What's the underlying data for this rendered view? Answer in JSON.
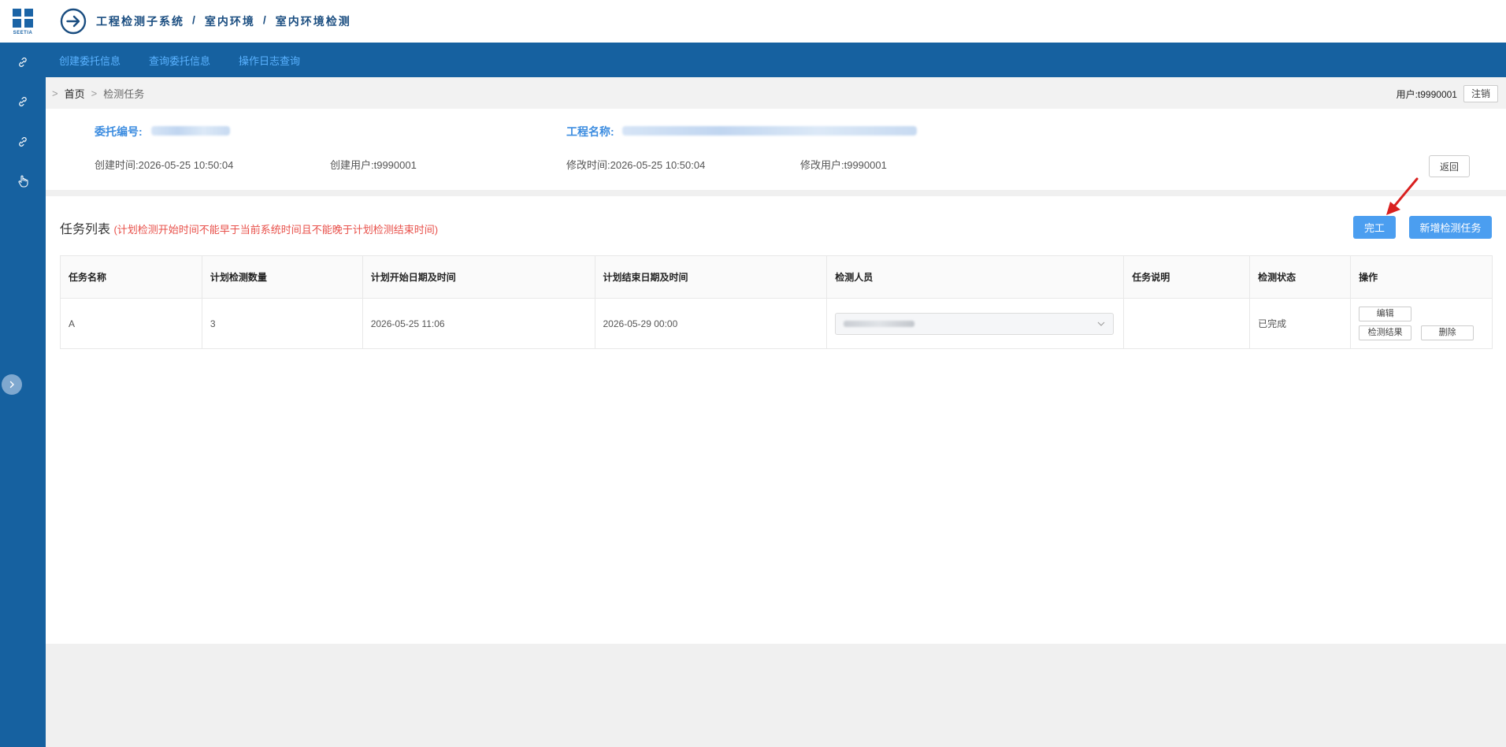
{
  "logo": {
    "text": "SEETIA"
  },
  "header": {
    "crumbs": [
      "工程检测子系统",
      "室内环境",
      "室内环境检测"
    ],
    "separator": "/"
  },
  "nav": {
    "items": [
      {
        "label": "创建委托信息"
      },
      {
        "label": "查询委托信息"
      },
      {
        "label": "操作日志查询"
      }
    ]
  },
  "rail": {
    "icons": [
      "link-icon",
      "link-icon",
      "link-icon",
      "pointer-hand-icon"
    ],
    "toggle_icon": "chevron-right-icon"
  },
  "subbar": {
    "sep": ">",
    "home": "首页",
    "current": "检测任务",
    "user_label": "用户:t9990001",
    "logout_label": "注销"
  },
  "info": {
    "entrust_no_label": "委托编号:",
    "project_name_label": "工程名称:",
    "created_time": "创建时间:2026-05-25 10:50:04",
    "created_user": "创建用户:t9990001",
    "modified_time": "修改时间:2026-05-25 10:50:04",
    "modified_user": "修改用户:t9990001",
    "back_label": "返回"
  },
  "tasks": {
    "title": "任务列表",
    "note": "(计划检测开始时间不能早于当前系统时间且不能晚于计划检测结束时间)",
    "finish_label": "完工",
    "add_label": "新增检测任务",
    "columns": [
      "任务名称",
      "计划检测数量",
      "计划开始日期及时间",
      "计划结束日期及时间",
      "检测人员",
      "任务说明",
      "检测状态",
      "操作"
    ],
    "rows": [
      {
        "name": "A",
        "quantity": "3",
        "start": "2026-05-25 11:06",
        "end": "2026-05-29 00:00",
        "inspector": "",
        "description": "",
        "status": "已完成",
        "edit_label": "编辑",
        "result_label": "检测结果",
        "delete_label": "删除"
      }
    ]
  },
  "colors": {
    "brand_blue": "#1661a0",
    "nav_link": "#5ab2ff",
    "primary_button": "#4b9ef0",
    "note_red": "#e8504a",
    "annotation_arrow": "#d9201f"
  }
}
